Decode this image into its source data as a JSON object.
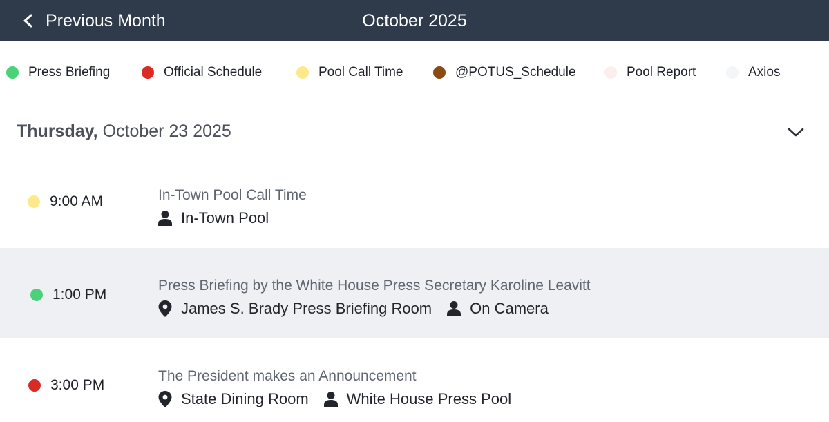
{
  "header": {
    "prev_label": "Previous Month",
    "month_title": "October 2025"
  },
  "legend": [
    {
      "label": "Press Briefing",
      "color": "#4cd17a"
    },
    {
      "label": "Official Schedule",
      "color": "#d92a23"
    },
    {
      "label": "Pool Call Time",
      "color": "#fde98c"
    },
    {
      "label": "@POTUS_Schedule",
      "color": "#8b4a12"
    },
    {
      "label": "Pool Report",
      "color": "#fdeeee"
    },
    {
      "label": "Axios",
      "color": "#f4f5f7"
    }
  ],
  "day": {
    "weekday": "Thursday,",
    "date": "October 23 2025"
  },
  "events": [
    {
      "time": "9:00 AM",
      "dot_color": "#fde98c",
      "title": "In-Town Pool Call Time",
      "meta": [
        {
          "icon": "person-icon",
          "text": "In-Town Pool"
        }
      ]
    },
    {
      "time": "1:00 PM",
      "dot_color": "#4cd17a",
      "title": "Press Briefing by the White House Press Secretary Karoline Leavitt",
      "meta": [
        {
          "icon": "location-pin-icon",
          "text": "James S. Brady Press Briefing Room"
        },
        {
          "icon": "person-icon",
          "text": "On Camera"
        }
      ]
    },
    {
      "time": "3:00 PM",
      "dot_color": "#d92a23",
      "title": "The President makes an Announcement",
      "meta": [
        {
          "icon": "location-pin-icon",
          "text": "State Dining Room"
        },
        {
          "icon": "person-icon",
          "text": "White House Press Pool"
        }
      ]
    }
  ]
}
